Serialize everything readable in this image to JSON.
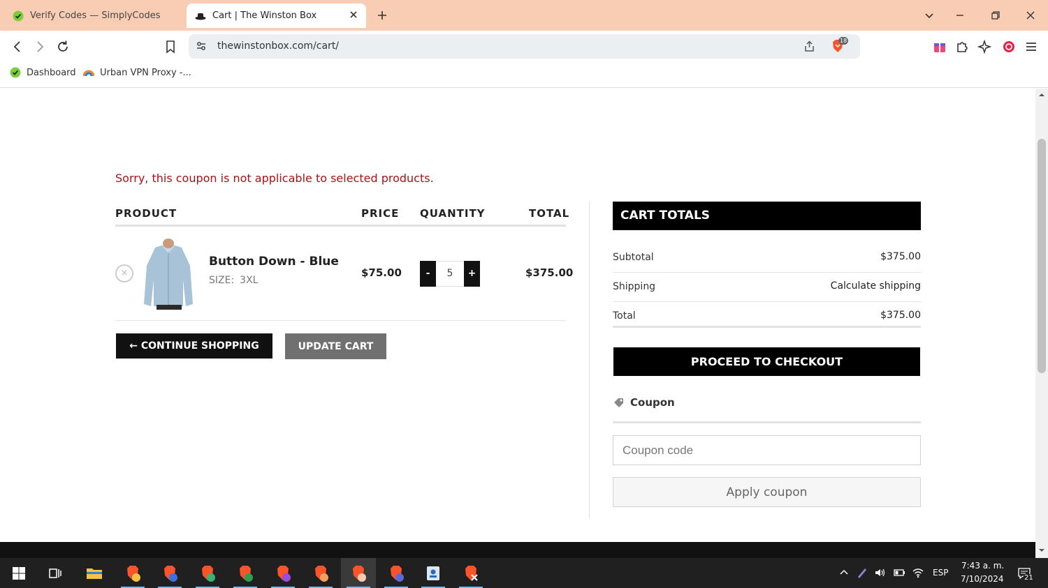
{
  "browser": {
    "tabs": [
      {
        "title": "Verify Codes — SimplyCodes",
        "active": false
      },
      {
        "title": "Cart | The Winston Box",
        "active": true
      }
    ],
    "url": "thewinstonbox.com/cart/",
    "shield_count": "18",
    "bookmarks": [
      {
        "label": "Dashboard"
      },
      {
        "label": "Urban VPN Proxy -..."
      }
    ]
  },
  "page": {
    "notice": "Sorry, this coupon is not applicable to selected products.",
    "cart_table": {
      "headers": {
        "product": "PRODUCT",
        "price": "PRICE",
        "quantity": "QUANTITY",
        "total": "TOTAL"
      },
      "item": {
        "remove_symbol": "×",
        "name": "Button Down - Blue",
        "size_label": "SIZE:",
        "size_value": "3XL",
        "price": "$75.00",
        "quantity": "5",
        "minus": "-",
        "plus": "+",
        "line_total": "$375.00"
      }
    },
    "buttons": {
      "continue": "← CONTINUE SHOPPING",
      "update": "UPDATE CART"
    },
    "totals": {
      "title": "CART TOTALS",
      "subtotal_label": "Subtotal",
      "subtotal_value": "$375.00",
      "shipping_label": "Shipping",
      "shipping_value": "Calculate shipping",
      "total_label": "Total",
      "total_value": "$375.00",
      "checkout": "PROCEED TO CHECKOUT"
    },
    "coupon": {
      "title": "Coupon",
      "placeholder": "Coupon code",
      "apply": "Apply coupon"
    }
  },
  "taskbar": {
    "language": "ESP",
    "time": "7:43 a. m.",
    "date": "7/10/2024",
    "notifications": "21"
  },
  "colors": {
    "tabstrip": "#f8cdb4",
    "error": "#a81313",
    "brand_black": "#000000",
    "update_button": "#707070"
  }
}
